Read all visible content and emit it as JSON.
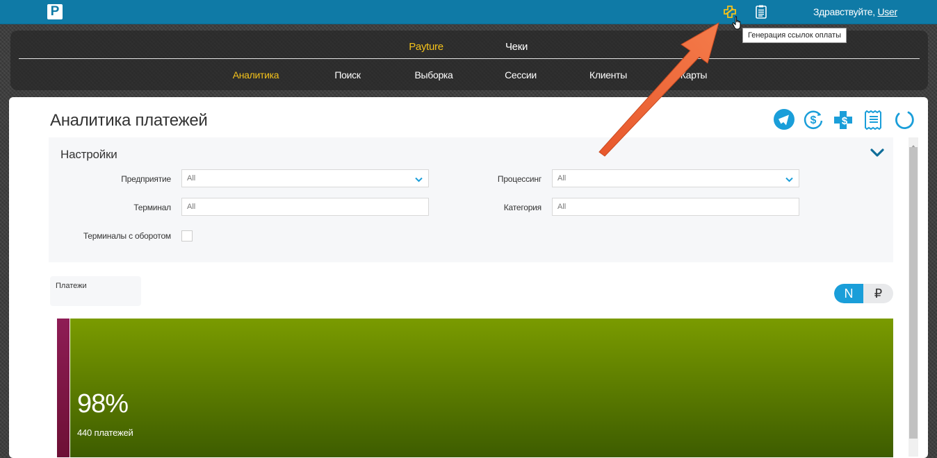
{
  "header": {
    "logo_letter": "P",
    "greeting_prefix": "Здравствуйте, ",
    "user_name": "User",
    "tooltip": "Генерация ссылок оплаты",
    "icons": [
      "payment-link-icon",
      "receipt-list-icon"
    ]
  },
  "nav": {
    "top": [
      {
        "label": "Payture",
        "active": true
      },
      {
        "label": "Чеки",
        "active": false
      }
    ],
    "sub": [
      {
        "label": "Аналитика",
        "active": true
      },
      {
        "label": "Поиск",
        "active": false
      },
      {
        "label": "Выборка",
        "active": false
      },
      {
        "label": "Сессии",
        "active": false
      },
      {
        "label": "Клиенты",
        "active": false
      },
      {
        "label": "Карты",
        "active": false
      }
    ]
  },
  "page": {
    "title": "Аналитика платежей",
    "toolbar_icons": [
      "telegram-icon",
      "dollar-refresh-icon",
      "add-payment-icon",
      "receipt-icon",
      "reload-icon"
    ]
  },
  "settings": {
    "title": "Настройки",
    "fields": {
      "enterprise": {
        "label": "Предприятие",
        "value": "All"
      },
      "processing": {
        "label": "Процессинг",
        "value": "All"
      },
      "terminal": {
        "label": "Терминал",
        "value": "All"
      },
      "category": {
        "label": "Категория",
        "value": "All"
      },
      "turnover": {
        "label": "Терминалы с оборотом",
        "checked": false
      }
    }
  },
  "payments": {
    "label": "Платежи",
    "toggle": {
      "count_label": "N",
      "sum_label": "₽",
      "selected": "N"
    }
  },
  "chart_data": {
    "type": "bar",
    "series": [
      {
        "name": "",
        "share": 0.02,
        "color": "#7a1543"
      },
      {
        "name": "",
        "share": 0.98,
        "color": "#6a8c00"
      }
    ],
    "percent_label": "98%",
    "count_label": "440 платежей"
  },
  "colors": {
    "topbar": "#0f7aa6",
    "accent": "#1a9ed9",
    "active_nav": "#f3c11b",
    "arrow": "#f26b3a"
  }
}
